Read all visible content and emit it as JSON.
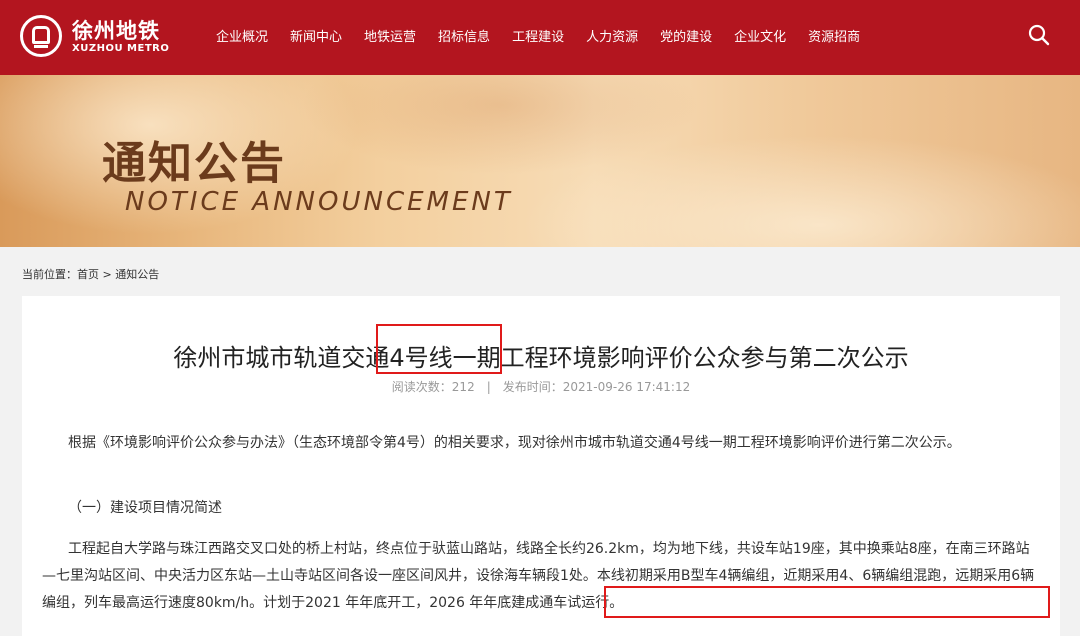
{
  "header": {
    "logo_cn": "徐州地铁",
    "logo_en": "XUZHOU METRO",
    "nav": [
      "企业概况",
      "新闻中心",
      "地铁运营",
      "招标信息",
      "工程建设",
      "人力资源",
      "党的建设",
      "企业文化",
      "资源招商"
    ],
    "search_icon": "search-icon",
    "brand_color": "#b3151f"
  },
  "banner": {
    "title": "通知公告",
    "subtitle": "NOTICE ANNOUNCEMENT"
  },
  "breadcrumb": {
    "prefix": "当前位置：",
    "home": "首页",
    "separator": ">",
    "current": "通知公告"
  },
  "article": {
    "title": "徐州市城市轨道交通4号线一期工程环境影响评价公众参与第二次公示",
    "views_label": "阅读次数：",
    "views": "212",
    "meta_sep": "|",
    "published_label": "发布时间：",
    "published": "2021-09-26 17:41:12",
    "paragraph1": "根据《环境影响评价公众参与办法》（生态环境部令第4号）的相关要求，现对徐州市城市轨道交通4号线一期工程环境影响评价进行第二次公示。",
    "section1": "（一）建设项目情况简述",
    "paragraph2": "工程起自大学路与珠江西路交叉口处的桥上村站，终点位于驮蓝山路站，线路全长约26.2km，均为地下线，共设车站19座，其中换乘站8座，在南三环路站—七里沟站区间、中央活力区东站—土山寺站区间各设一座区间风井，设徐海车辆段1处。本线初期采用B型车4辆编组，近期采用4、6辆编组混跑，远期采用6辆编组，列车最高运行速度80km/h。计划于2021 年年底开工，2026 年年底建成通车试运行。",
    "highlight_color": "#e01a1a"
  }
}
